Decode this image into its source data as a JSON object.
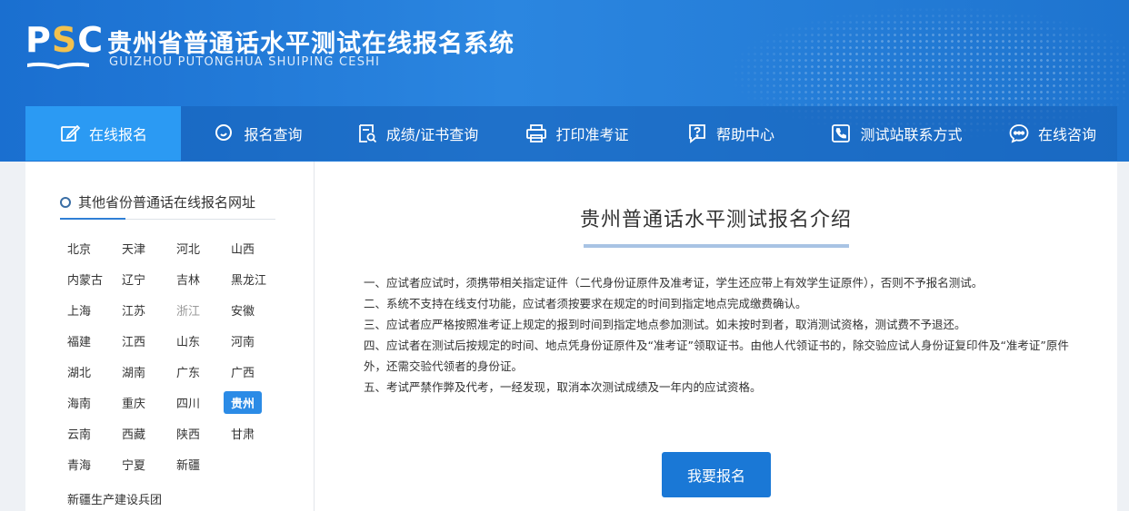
{
  "header": {
    "logo_text": "PSC",
    "title": "贵州省普通话水平测试在线报名系统",
    "subtitle": "GUIZHOU PUTONGHUA SHUIPING CESHI"
  },
  "nav": {
    "items": [
      {
        "label": "在线报名",
        "icon": "edit-icon",
        "active": true
      },
      {
        "label": "报名查询",
        "icon": "search-icon"
      },
      {
        "label": "成绩/证书查询",
        "icon": "document-search-icon"
      },
      {
        "label": "打印准考证",
        "icon": "printer-icon"
      },
      {
        "label": "帮助中心",
        "icon": "help-icon"
      },
      {
        "label": "测试站联系方式",
        "icon": "phone-icon"
      },
      {
        "label": "在线咨询",
        "icon": "chat-icon"
      }
    ]
  },
  "sidebar": {
    "title": "其他省份普通话在线报名网址",
    "provinces": [
      "北京",
      "天津",
      "河北",
      "山西",
      "内蒙古",
      "辽宁",
      "吉林",
      "黑龙江",
      "上海",
      "江苏",
      "浙江",
      "安徽",
      "福建",
      "江西",
      "山东",
      "河南",
      "湖北",
      "湖南",
      "广东",
      "广西",
      "海南",
      "重庆",
      "四川",
      "贵州",
      "云南",
      "西藏",
      "陕西",
      "甘肃",
      "青海",
      "宁夏",
      "新疆"
    ],
    "extra": "新疆生产建设兵团",
    "active_province": "贵州",
    "muted_province": "浙江"
  },
  "main": {
    "title": "贵州普通话水平测试报名介绍",
    "notices": [
      "一、应试者应试时，须携带相关指定证件（二代身份证原件及准考证，学生还应带上有效学生证原件），否则不予报名测试。",
      "二、系统不支持在线支付功能，应试者须按要求在规定的时间到指定地点完成缴费确认。",
      "三、应试者应严格按照准考证上规定的报到时间到指定地点参加测试。如未按时到者，取消测试资格，测试费不予退还。",
      "四、应试者在测试后按规定的时间、地点凭身份证原件及“准考证”领取证书。由他人代领证书的，除交验应试人身份证复印件及“准考证”原件外，还需交验代领者的身份证。",
      "五、考试严禁作弊及代考，一经发现，取消本次测试成绩及一年内的应试资格。"
    ],
    "apply_button": "我要报名"
  },
  "colors": {
    "header_blue": "#1a6fd0",
    "nav_active": "#2b9af3",
    "button_blue": "#1a78d6",
    "logo_accent": "#f2c14e"
  }
}
